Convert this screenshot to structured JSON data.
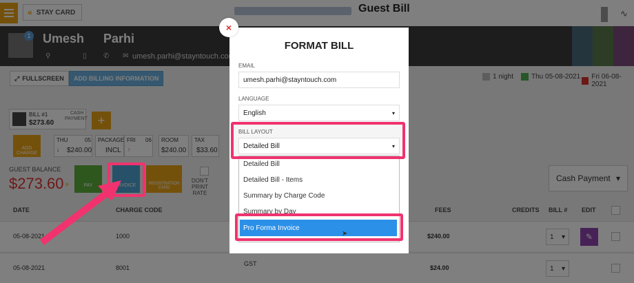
{
  "header": {
    "stay_card_label": "STAY CARD",
    "title": "Guest Bill"
  },
  "guest": {
    "first_name": "Umesh",
    "last_name": "Parhi",
    "email": "umesh.parhi@stayntouch.com",
    "badge_count": "1"
  },
  "toolbar": {
    "fullscreen_label": "FULLSCREEN",
    "add_billing_label": "ADD BILLING INFORMATION",
    "nights": "1 night",
    "arrival": "Thu 05-08-2021",
    "departure": "Fri 06-08-2021"
  },
  "bill_card": {
    "title": "BILL #1",
    "amount": "$273.60",
    "type_line1": "CASH",
    "type_line2": "PAYMENT"
  },
  "tiles": {
    "add_charge": "ADD CHARGE",
    "day1_label": "THU",
    "day1_date": "05",
    "day1_amount": "$240.00",
    "packages_label": "PACKAGES",
    "packages_value": "INCL",
    "day2_label": "FRI",
    "day2_date": "06",
    "room_label": "ROOM",
    "room_value": "$240.00",
    "tax_label": "TAX",
    "tax_value": "$33.60"
  },
  "balance": {
    "label": "GUEST BALANCE",
    "value": "$273.60"
  },
  "actions": {
    "pay": "PAY",
    "invoice": "INVOICE",
    "registration_card": "REGISTRATION CARD",
    "dont_print_rate": "DON'T PRINT RATE"
  },
  "payment_select": "Cash Payment",
  "table": {
    "headers": {
      "date": "DATE",
      "charge_code": "CHARGE CODE",
      "fees": "FEES",
      "credits": "CREDITS",
      "bill": "BILL #",
      "edit": "EDIT"
    },
    "rows": [
      {
        "date": "05-08-2021",
        "charge_code": "1000",
        "description": "",
        "fees": "$240.00",
        "bill": "1"
      },
      {
        "date": "05-08-2021",
        "charge_code": "8001",
        "description": "GST",
        "fees": "$24.00",
        "bill": "1"
      }
    ]
  },
  "modal": {
    "close_label": "×",
    "title": "FORMAT BILL",
    "email_label": "EMAIL",
    "email_value": "umesh.parhi@stayntouch.com",
    "language_label": "LANGUAGE",
    "language_value": "English",
    "layout_label": "BILL LAYOUT",
    "layout_value": "Detailed Bill",
    "options": [
      "Detailed Bill",
      "Detailed Bill - Items",
      "Summary by Charge Code",
      "Summary by Day",
      "Pro Forma Invoice"
    ]
  },
  "colors": {
    "accent": "#e8a317",
    "highlight": "#f0336f",
    "selected_option": "#2b90e8",
    "balance": "#e03030"
  }
}
